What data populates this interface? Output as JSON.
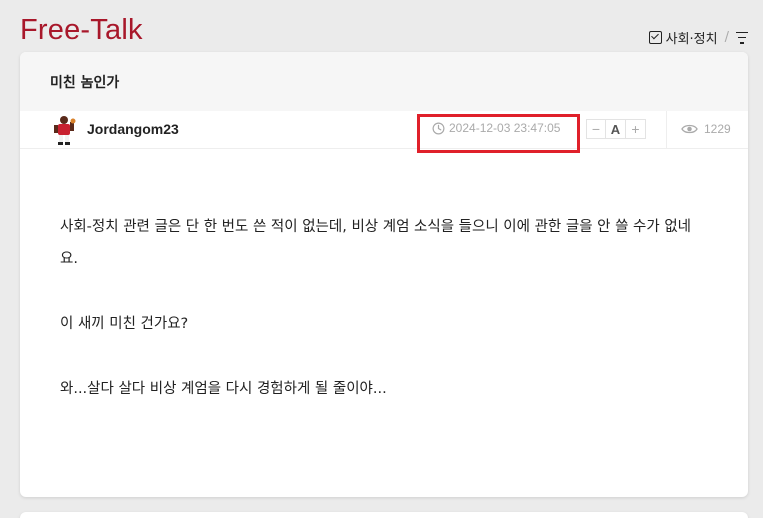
{
  "board": {
    "title": "Free-Talk"
  },
  "filter": {
    "category_label": "사회·정치",
    "separator": "/"
  },
  "post": {
    "title": "미친 놈인가",
    "author": "Jordangom23",
    "datetime": "2024-12-03 23:47:05",
    "fontsize": {
      "decrease": "−",
      "label": "A",
      "increase": "+"
    },
    "views": "1229",
    "paragraphs": [
      "사회-정치 관련 글은 단 한 번도 쓴 적이 없는데, 비상 계엄 소식을 들으니 이에 관한 글을 안 쓸 수가 없네요.",
      "이 새끼 미친 건가요?",
      "와...살다 살다 비상 계엄을 다시 경험하게 될 줄이야..."
    ]
  },
  "colors": {
    "brand": "#a8172a",
    "highlight": "#e0202a",
    "muted": "#aaaaaa"
  },
  "icons": {
    "checkbox": "checkbox-checked-icon",
    "filter": "filter-icon",
    "clock": "clock-icon",
    "eye": "eye-icon",
    "avatar": "avatar-icon"
  }
}
